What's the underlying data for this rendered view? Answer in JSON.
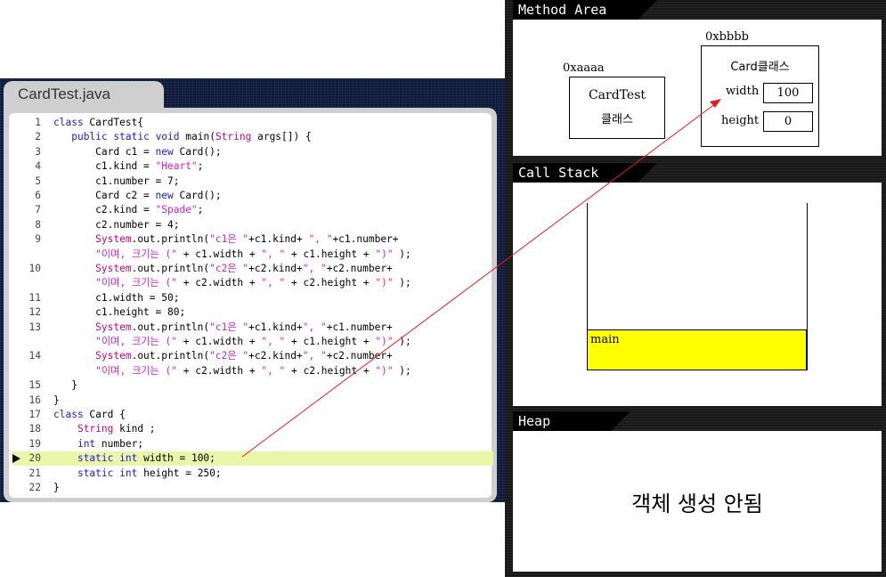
{
  "editor": {
    "tab_title": "CardTest.java",
    "lines": [
      {
        "n": "1",
        "code": "class CardTest{"
      },
      {
        "n": "2",
        "code": "   public static void main(String args[]) {"
      },
      {
        "n": "3",
        "code": "       Card c1 = new Card();"
      },
      {
        "n": "4",
        "code": "       c1.kind = \"Heart\";"
      },
      {
        "n": "5",
        "code": "       c1.number = 7;"
      },
      {
        "n": "6",
        "code": "       Card c2 = new Card();"
      },
      {
        "n": "7",
        "code": "       c2.kind = \"Spade\";"
      },
      {
        "n": "8",
        "code": "       c2.number = 4;"
      },
      {
        "n": "9",
        "code": "       System.out.println(\"c1은 \"+c1.kind+ \", \"+c1.number+"
      },
      {
        "n": "",
        "code": "       \"이며, 크기는 (\" + c1.width + \", \" + c1.height + \")\" );"
      },
      {
        "n": "10",
        "code": "       System.out.println(\"c2은 \"+c2.kind+\", \"+c2.number+"
      },
      {
        "n": "",
        "code": "       \"이며, 크기는 (\" + c2.width + \", \" + c2.height + \")\" );"
      },
      {
        "n": "11",
        "code": "       c1.width = 50;"
      },
      {
        "n": "12",
        "code": "       c1.height = 80;"
      },
      {
        "n": "13",
        "code": "       System.out.println(\"c1은 \"+c1.kind+\", \"+c1.number+"
      },
      {
        "n": "",
        "code": "       \"이며, 크기는 (\" + c1.width + \", \" + c1.height + \")\" );"
      },
      {
        "n": "14",
        "code": "       System.out.println(\"c2은 \"+c2.kind+\", \"+c2.number+"
      },
      {
        "n": "",
        "code": "       \"이며, 크기는 (\" + c2.width + \", \" + c2.height + \")\" );"
      },
      {
        "n": "15",
        "code": "   }"
      },
      {
        "n": "16",
        "code": "}"
      },
      {
        "n": "17",
        "code": "class Card {"
      },
      {
        "n": "18",
        "code": "    String kind ;"
      },
      {
        "n": "19",
        "code": "    int number;"
      },
      {
        "n": "20",
        "code": "    static int width = 100;"
      },
      {
        "n": "21",
        "code": "    static int height = 250;"
      },
      {
        "n": "22",
        "code": "}"
      }
    ]
  },
  "method_area": {
    "title": "Method Area",
    "cardtest_addr": "0xaaaa",
    "cardtest_label_1": "CardTest",
    "cardtest_label_2": "클래스",
    "card_addr": "0xbbbb",
    "card_label": "Card클래스",
    "width_label": "width",
    "width_value": "100",
    "height_label": "height",
    "height_value": "0"
  },
  "call_stack": {
    "title": "Call Stack",
    "frame": "main"
  },
  "heap": {
    "title": "Heap",
    "message": "객체 생성 안됨"
  },
  "colors": {
    "arrow": "#e02020",
    "highlight": "#eaf7a8",
    "stack_frame": "#ffff00"
  }
}
